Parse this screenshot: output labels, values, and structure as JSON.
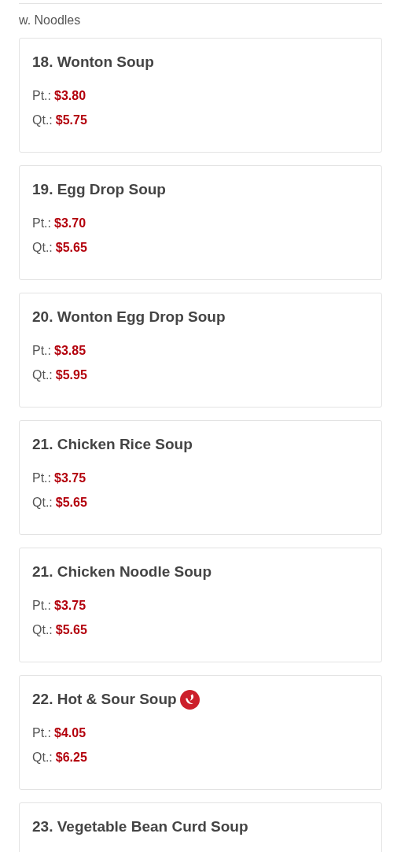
{
  "previous_note": "w. Noodles",
  "items": [
    {
      "title": "18. Wonton Soup",
      "spicy": false,
      "prices": [
        {
          "label": "Pt.:",
          "price": "$3.80"
        },
        {
          "label": "Qt.:",
          "price": "$5.75"
        }
      ]
    },
    {
      "title": "19. Egg Drop Soup",
      "spicy": false,
      "prices": [
        {
          "label": "Pt.:",
          "price": "$3.70"
        },
        {
          "label": "Qt.:",
          "price": "$5.65"
        }
      ]
    },
    {
      "title": "20. Wonton Egg Drop Soup",
      "spicy": false,
      "prices": [
        {
          "label": "Pt.:",
          "price": "$3.85"
        },
        {
          "label": "Qt.:",
          "price": "$5.95"
        }
      ]
    },
    {
      "title": "21. Chicken Rice Soup",
      "spicy": false,
      "prices": [
        {
          "label": "Pt.:",
          "price": "$3.75"
        },
        {
          "label": "Qt.:",
          "price": "$5.65"
        }
      ]
    },
    {
      "title": "21. Chicken Noodle Soup",
      "spicy": false,
      "prices": [
        {
          "label": "Pt.:",
          "price": "$3.75"
        },
        {
          "label": "Qt.:",
          "price": "$5.65"
        }
      ]
    },
    {
      "title": "22. Hot & Sour Soup",
      "spicy": true,
      "prices": [
        {
          "label": "Pt.:",
          "price": "$4.05"
        },
        {
          "label": "Qt.:",
          "price": "$6.25"
        }
      ]
    },
    {
      "title": "23. Vegetable Bean Curd Soup",
      "spicy": false
    }
  ]
}
